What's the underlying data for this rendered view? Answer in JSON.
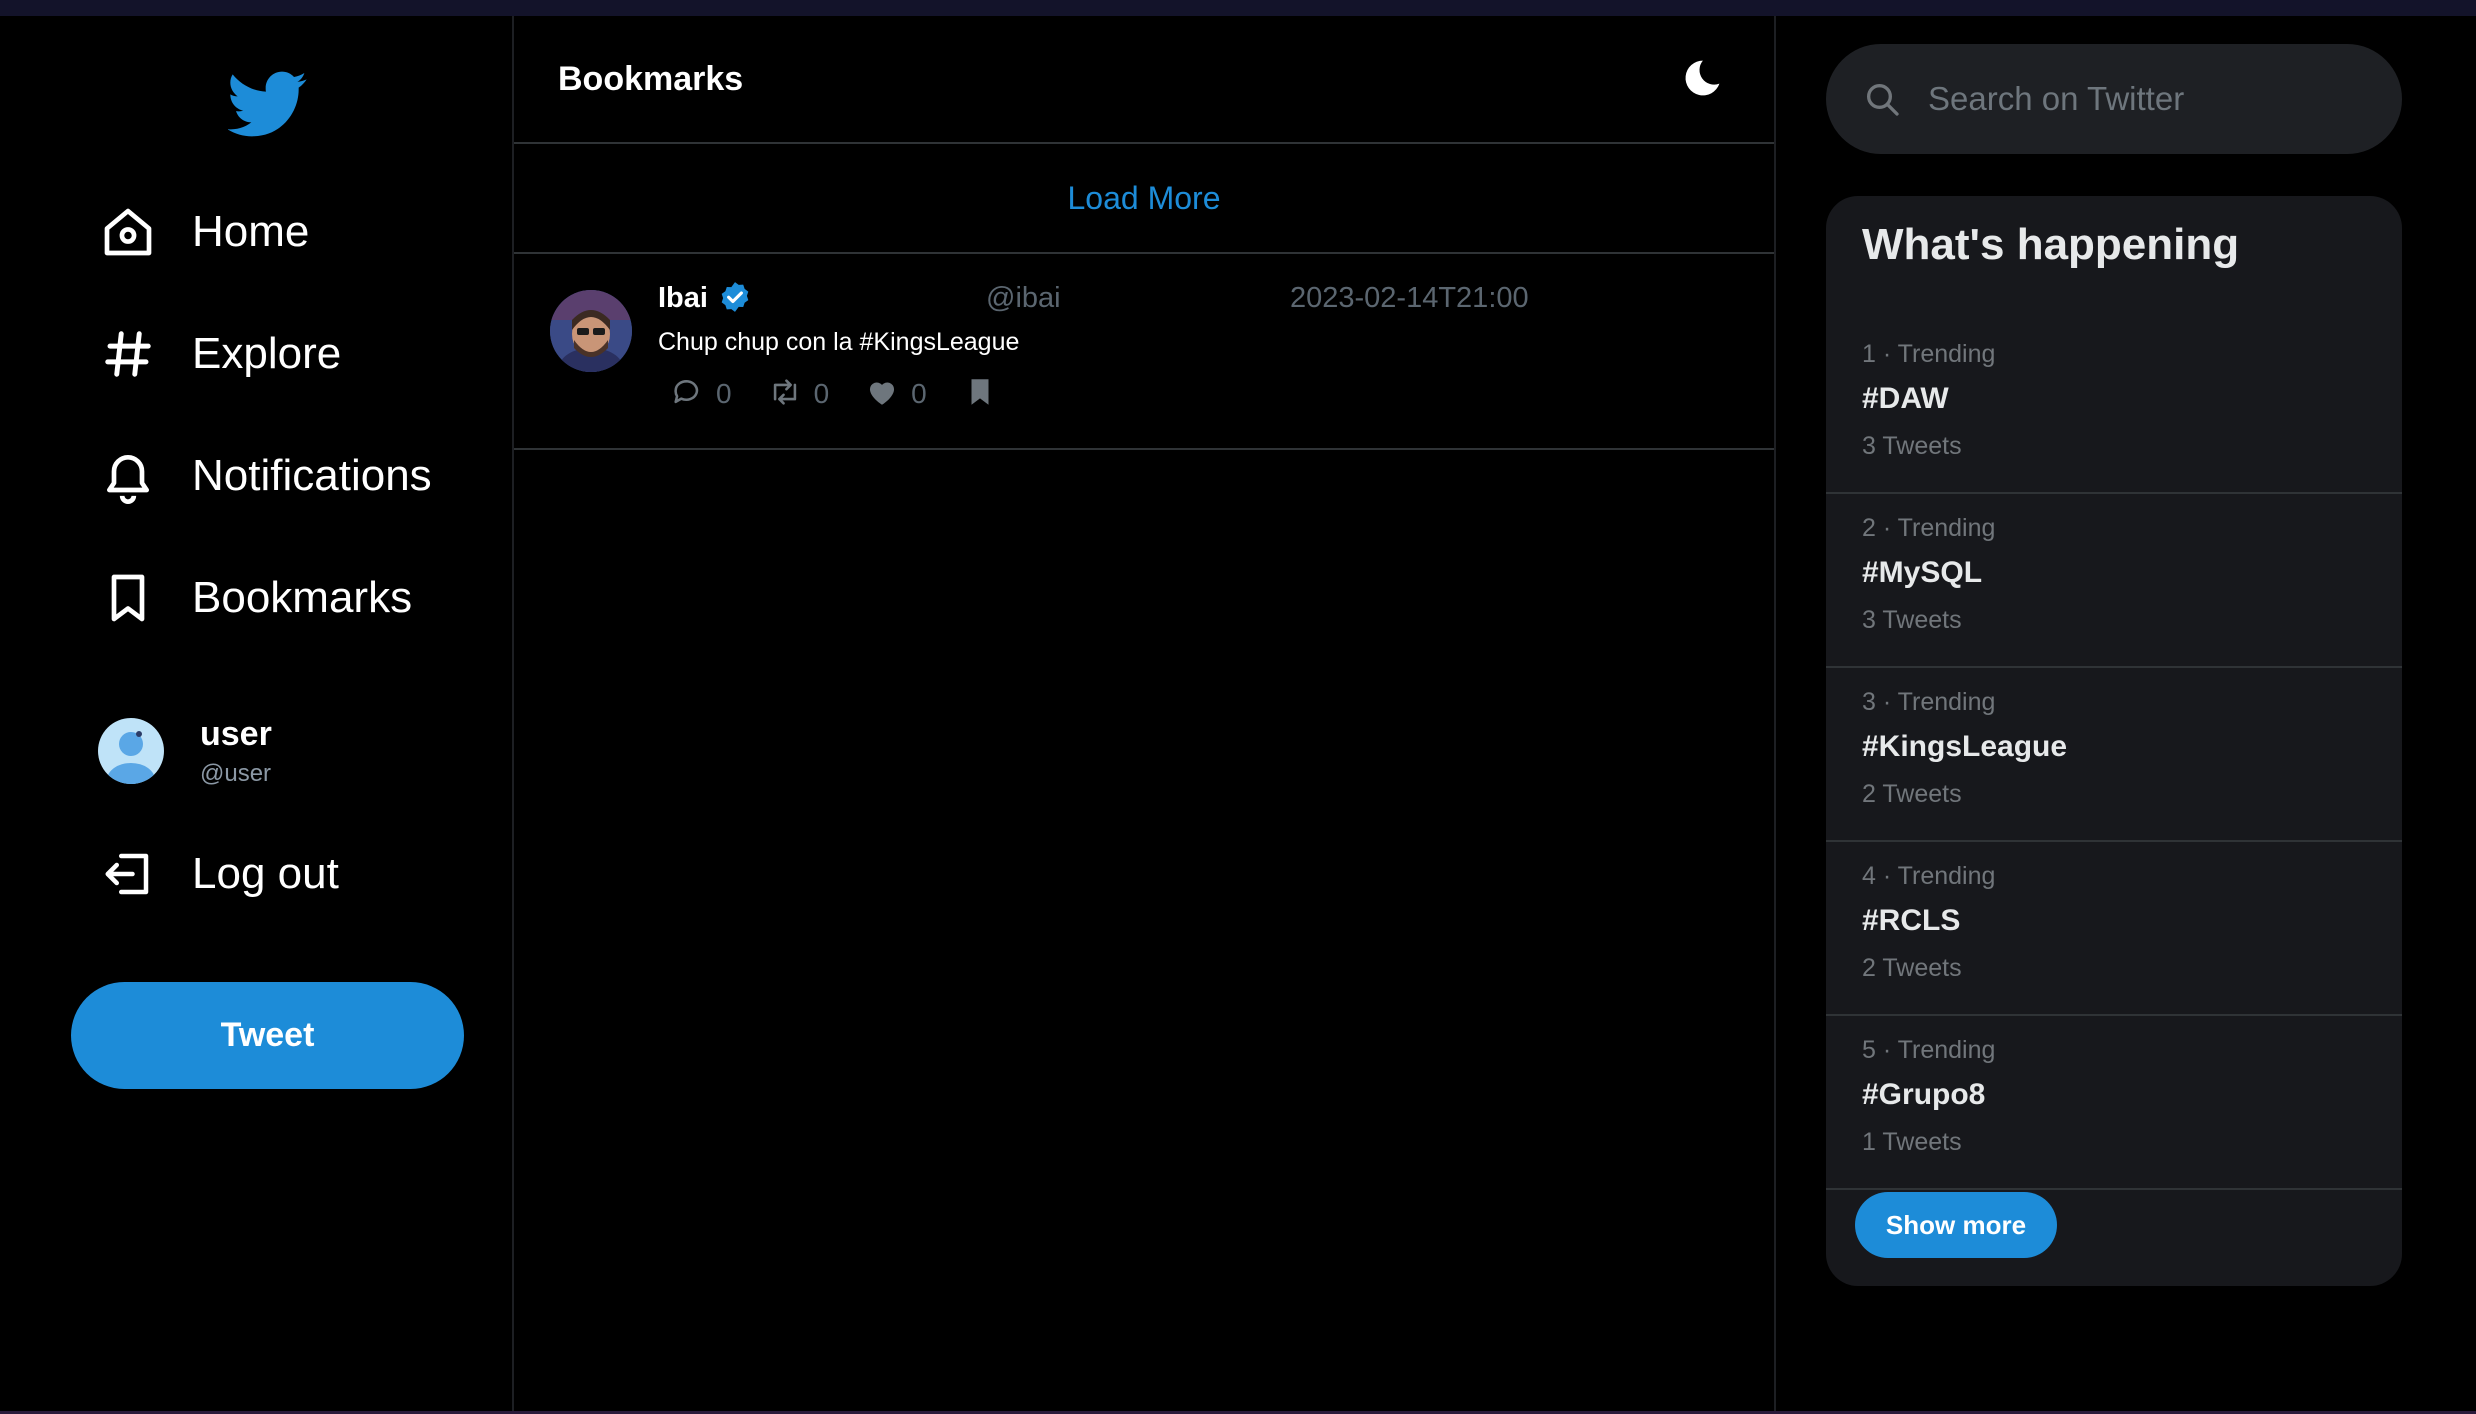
{
  "sidebar": {
    "nav": [
      {
        "label": "Home",
        "icon": "home-icon"
      },
      {
        "label": "Explore",
        "icon": "hashtag-icon"
      },
      {
        "label": "Notifications",
        "icon": "bell-icon"
      },
      {
        "label": "Bookmarks",
        "icon": "bookmark-icon"
      }
    ],
    "profile": {
      "name": "user",
      "handle": "@user"
    },
    "logout_label": "Log out",
    "tweet_button": "Tweet"
  },
  "main": {
    "title": "Bookmarks",
    "load_more": "Load More",
    "tweets": [
      {
        "name": "Ibai",
        "verified": true,
        "handle": "@ibai",
        "date": "2023-02-14T21:00",
        "text": "Chup chup con la #KingsLeague",
        "replies": "0",
        "retweets": "0",
        "likes": "0"
      }
    ]
  },
  "search": {
    "placeholder": "Search on Twitter"
  },
  "trends": {
    "title": "What's happening",
    "items": [
      {
        "meta": "1 · Trending",
        "tag": "#DAW",
        "count": "3 Tweets"
      },
      {
        "meta": "2 · Trending",
        "tag": "#MySQL",
        "count": "3 Tweets"
      },
      {
        "meta": "3 · Trending",
        "tag": "#KingsLeague",
        "count": "2 Tweets"
      },
      {
        "meta": "4 · Trending",
        "tag": "#RCLS",
        "count": "2 Tweets"
      },
      {
        "meta": "5 · Trending",
        "tag": "#Grupo8",
        "count": "1 Tweets"
      }
    ],
    "show_more": "Show more"
  },
  "colors": {
    "accent": "#1d8cd8",
    "background": "#000000",
    "panel": "#17181c",
    "muted_text": "#71767b"
  }
}
